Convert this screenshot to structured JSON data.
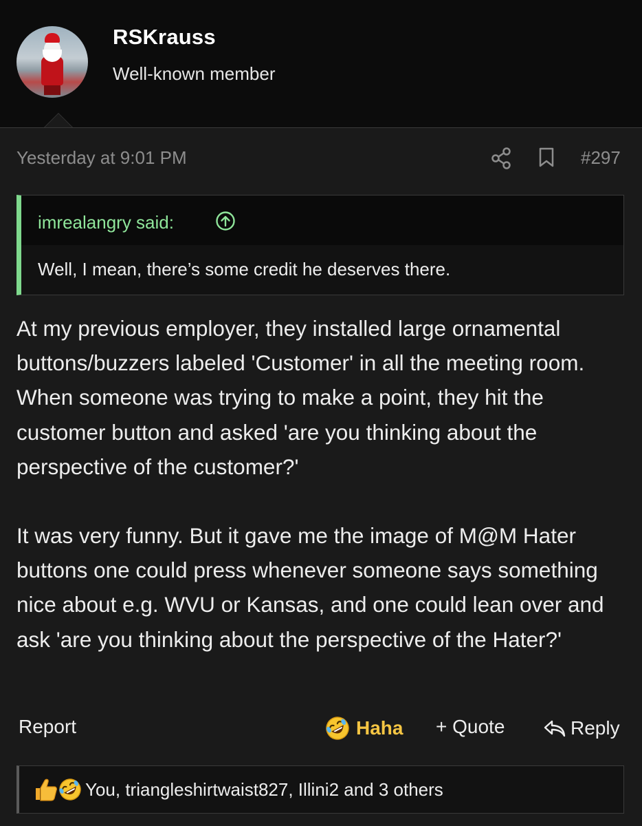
{
  "author": {
    "name": "RSKrauss",
    "title": "Well-known member"
  },
  "post": {
    "timestamp": "Yesterday at 9:01 PM",
    "number": "#297"
  },
  "quote": {
    "author_label": "imrealangry said:",
    "text": "Well, I mean, there’s some credit he deserves there."
  },
  "body": {
    "paragraphs": [
      "At my previous employer, they installed large ornamental buttons/buzzers labeled 'Customer' in all the meeting room. When someone was trying to make a point, they hit the customer button and asked 'are you thinking about the perspective of the customer?'",
      "It was very funny. But it gave me the image of M@M Hater buttons one could press whenever someone says something nice about e.g. WVU or Kansas, and one could lean over and ask 'are you thinking about the perspective of the Hater?'"
    ]
  },
  "actions": {
    "report": "Report",
    "haha": "Haha",
    "quote": "+ Quote",
    "reply": "Reply"
  },
  "reactions": {
    "text": "You, triangleshirtwaist827, Illini2 and 3 others",
    "icons": [
      "thumbs-up-icon",
      "rofl-icon"
    ]
  },
  "colors": {
    "background": "#1a1a1a",
    "header_background": "#0c0c0c",
    "quote_accent": "#7fd98d",
    "haha_accent": "#f5c543",
    "muted_text": "#8d8d8d"
  }
}
